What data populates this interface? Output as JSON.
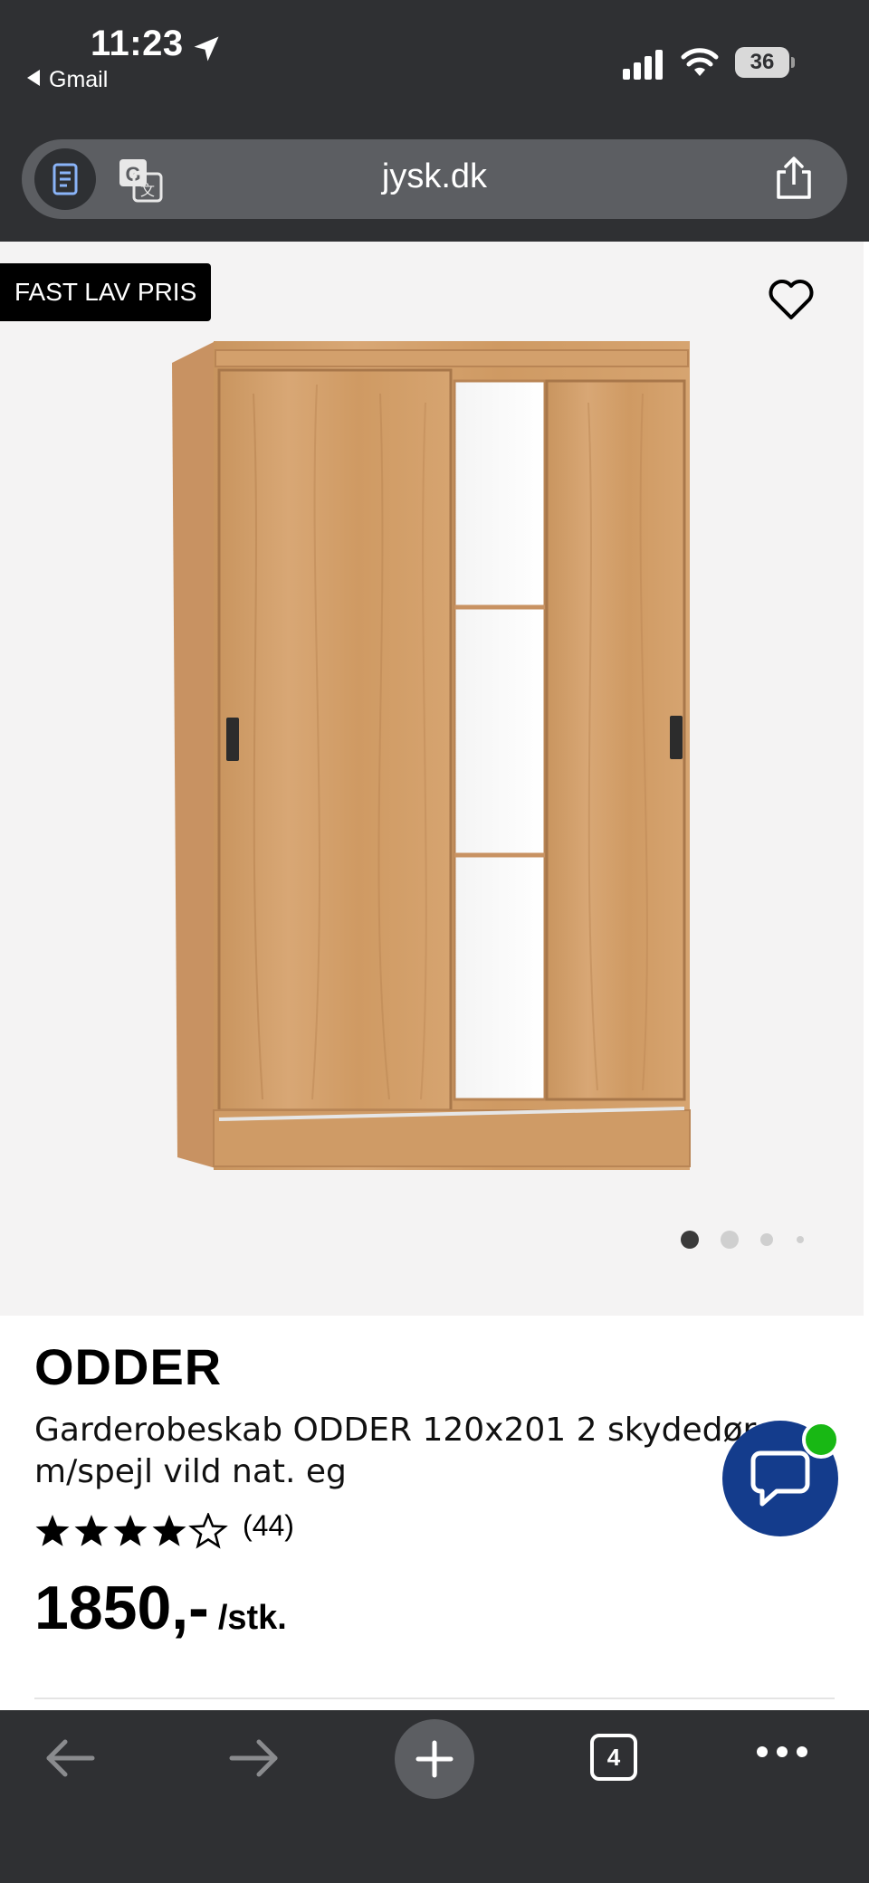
{
  "status_bar": {
    "time": "11:23",
    "back_app": "Gmail",
    "battery": "36"
  },
  "address_bar": {
    "url": "jysk.dk",
    "icons": [
      "reader-icon",
      "translate-icon",
      "share-icon"
    ]
  },
  "product": {
    "badge": "FAST LAV PRIS",
    "name": "ODDER",
    "description_line1": "Garderobeskab ODDER 120x201 2 skydedør",
    "description_line2": "m/spejl vild nat. eg",
    "rating": 4.5,
    "rating_max": 5,
    "review_count": "(44)",
    "price": "1850,-",
    "price_unit": "/stk.",
    "image_count": 4,
    "active_image": 1
  },
  "chat": {
    "online_color": "#18b814",
    "button_color": "#143c8c"
  },
  "toolbar": {
    "tab_count": "4",
    "icons": [
      "back-arrow-icon",
      "forward-arrow-icon",
      "plus-icon",
      "tabs-icon",
      "more-icon"
    ]
  }
}
